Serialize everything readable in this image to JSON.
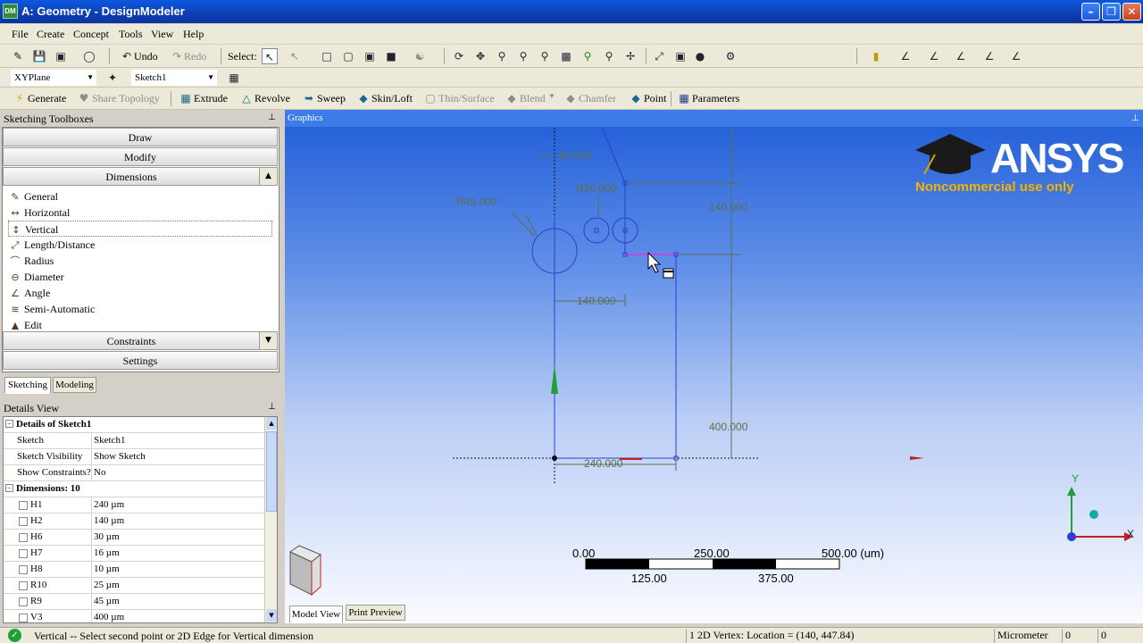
{
  "window": {
    "title": "A: Geometry - DesignModeler",
    "app_icon": "DM"
  },
  "menu": [
    "File",
    "Create",
    "Concept",
    "Tools",
    "View",
    "Help"
  ],
  "toolbar1": {
    "undo": "Undo",
    "redo": "Redo",
    "select_label": "Select:"
  },
  "toolbar2": {
    "plane": "XYPlane",
    "sketch": "Sketch1"
  },
  "toolbar3": {
    "generate": "Generate",
    "share_topology": "Share Topology",
    "extrude": "Extrude",
    "revolve": "Revolve",
    "sweep": "Sweep",
    "skin_loft": "Skin/Loft",
    "thin_surface": "Thin/Surface",
    "blend": "Blend",
    "chamfer": "Chamfer",
    "point": "Point",
    "parameters": "Parameters"
  },
  "sketching": {
    "title": "Sketching Toolboxes",
    "draw": "Draw",
    "modify": "Modify",
    "dimensions": "Dimensions",
    "constraints": "Constraints",
    "settings": "Settings",
    "tools": [
      "General",
      "Horizontal",
      "Vertical",
      "Length/Distance",
      "Radius",
      "Diameter",
      "Angle",
      "Semi-Automatic",
      "Edit"
    ],
    "tabs": {
      "sketching": "Sketching",
      "modeling": "Modeling"
    }
  },
  "details": {
    "title": "Details View",
    "header": "Details of Sketch1",
    "rows": [
      {
        "k": "Sketch",
        "v": "Sketch1"
      },
      {
        "k": "Sketch Visibility",
        "v": "Show Sketch"
      },
      {
        "k": "Show Constraints?",
        "v": "No"
      }
    ],
    "dims_header": "Dimensions: 10",
    "dims": [
      {
        "k": "H1",
        "v": "240 µm"
      },
      {
        "k": "H2",
        "v": "140 µm"
      },
      {
        "k": "H6",
        "v": "30 µm"
      },
      {
        "k": "H7",
        "v": "16 µm"
      },
      {
        "k": "H8",
        "v": "10 µm"
      },
      {
        "k": "R10",
        "v": "25 µm"
      },
      {
        "k": "R9",
        "v": "45 µm"
      },
      {
        "k": "V3",
        "v": "400 µm"
      }
    ]
  },
  "graphics": {
    "title": "Graphics",
    "logo": {
      "brand": "ANSYS",
      "note": "Noncommercial use only"
    },
    "dims": {
      "top": "40.000",
      "r25": "R25.000",
      "r45": "R45.000",
      "v140": "140.000",
      "h140": "140.000",
      "v400": "400.000",
      "h240": "240.000"
    },
    "scale": {
      "t0": "0.00",
      "t1": "250.00",
      "t2": "500.00 (um)",
      "b1": "125.00",
      "b2": "375.00"
    },
    "axes": {
      "x": "X",
      "y": "Y"
    },
    "tabs": {
      "model_view": "Model View",
      "print_preview": "Print Preview"
    }
  },
  "status": {
    "message": "Vertical -- Select second point or 2D Edge for Vertical dimension",
    "selection": "1 2D Vertex: Location = (140, 447.84)",
    "units": "Micrometer",
    "c1": "0",
    "c2": "0"
  },
  "colors": {
    "accent": "#3d7be6",
    "sketch_line": "#2b3fcf",
    "dimension": "#5e6e4e"
  }
}
